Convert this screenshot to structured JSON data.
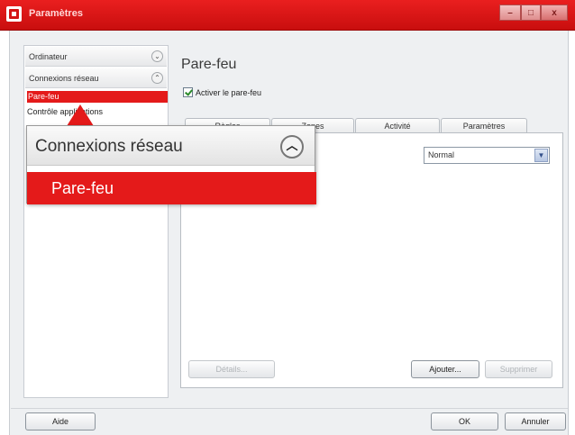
{
  "window": {
    "title": "Paramètres",
    "controls": {
      "minimize": "–",
      "maximize": "□",
      "close": "x"
    }
  },
  "sidebar": {
    "sections": [
      {
        "label": "Ordinateur",
        "state_icon": "chevron-down-icon",
        "chevron": "⌄"
      },
      {
        "label": "Connexions réseau",
        "state_icon": "chevron-up-icon",
        "chevron": "⌃"
      }
    ],
    "items": [
      {
        "label": "Pare-feu",
        "selected": true
      },
      {
        "label": "Contrôle applications",
        "selected": false
      }
    ]
  },
  "main": {
    "title": "Pare-feu",
    "activate": {
      "label": "Activer le pare-feu",
      "checked": true
    },
    "tabs": [
      {
        "label": "Règles",
        "active": true
      },
      {
        "label": "Zones",
        "active": false
      },
      {
        "label": "Activité",
        "active": false
      },
      {
        "label": "Paramètres",
        "active": false
      }
    ],
    "level_select": {
      "value": "Normal"
    },
    "buttons": {
      "details": "Détails...",
      "add": "Ajouter...",
      "delete": "Supprimer"
    }
  },
  "footer": {
    "help": "Aide",
    "ok": "OK",
    "cancel": "Annuler"
  },
  "callout": {
    "section_label": "Connexions réseau",
    "chevron": "︿",
    "selected_label": "Pare-feu"
  },
  "colors": {
    "accent": "#e41a1a",
    "title_bar": "#d41515",
    "window_bg": "#eef0f2"
  }
}
